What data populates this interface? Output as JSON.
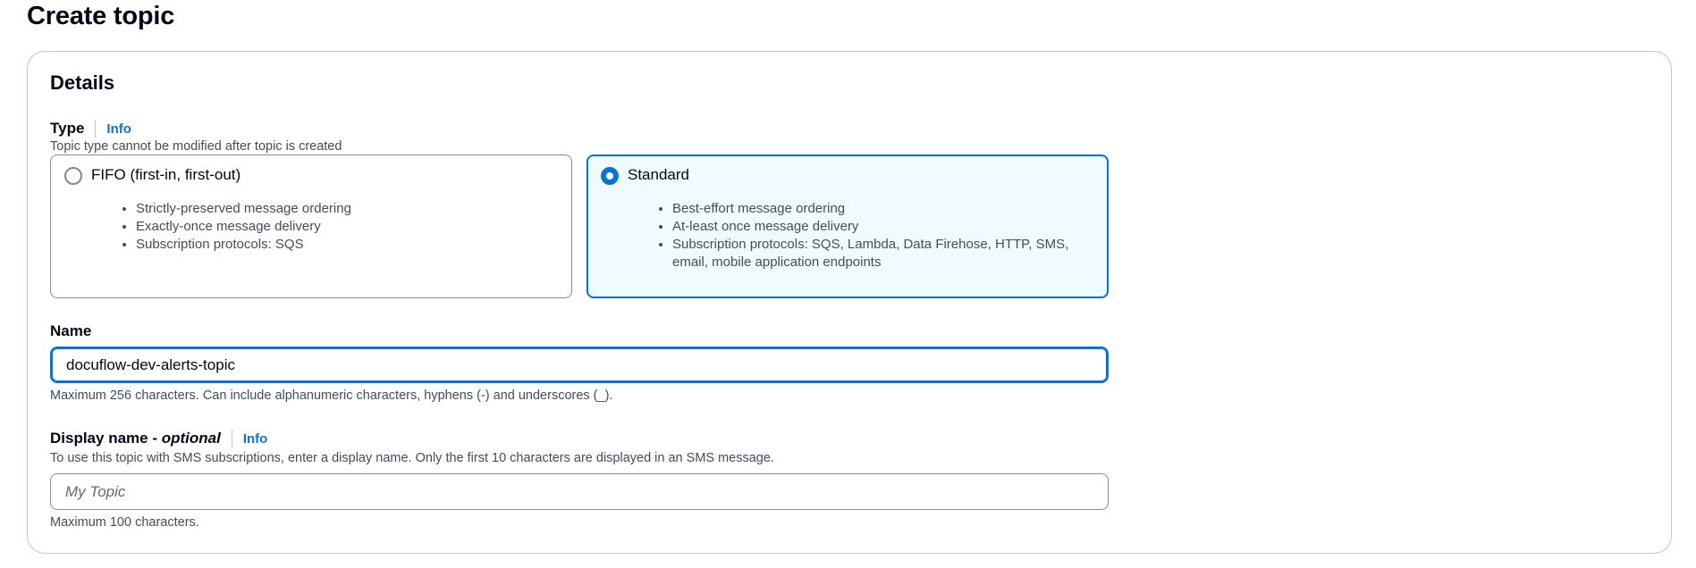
{
  "page": {
    "title": "Create topic"
  },
  "details": {
    "title": "Details",
    "type": {
      "label": "Type",
      "info": "Info",
      "description": "Topic type cannot be modified after topic is created",
      "options": [
        {
          "title": "FIFO (first-in, first-out)",
          "selected": false,
          "bullets": [
            "Strictly-preserved message ordering",
            "Exactly-once message delivery",
            "Subscription protocols: SQS"
          ]
        },
        {
          "title": "Standard",
          "selected": true,
          "bullets": [
            "Best-effort message ordering",
            "At-least once message delivery",
            "Subscription protocols: SQS, Lambda, Data Firehose, HTTP, SMS, email, mobile application endpoints"
          ]
        }
      ]
    },
    "name": {
      "label": "Name",
      "value": "docuflow-dev-alerts-topic",
      "hint": "Maximum 256 characters. Can include alphanumeric characters, hyphens (-) and underscores (_)."
    },
    "display_name": {
      "label": "Display name - ",
      "optional": "optional",
      "info": "Info",
      "description": "To use this topic with SMS subscriptions, enter a display name. Only the first 10 characters are displayed in an SMS message.",
      "placeholder": "My Topic",
      "hint": "Maximum 100 characters."
    }
  },
  "colors": {
    "accent": "#0972d3",
    "selected_bg": "#f0fbff",
    "border": "#8c8c94"
  }
}
